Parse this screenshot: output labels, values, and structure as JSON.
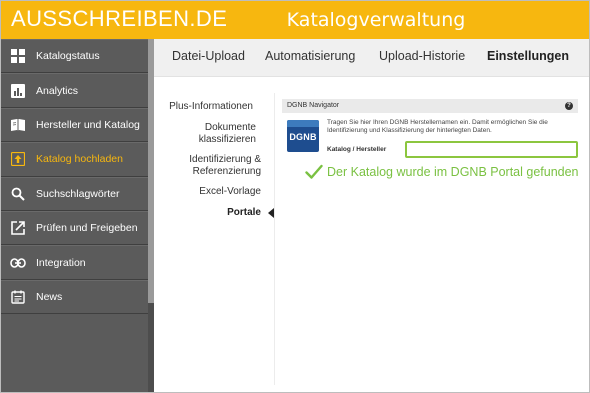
{
  "header": {
    "logo": "AUSSCHREIBEN",
    "logo_dot": ".",
    "logo_tld": "DE",
    "title": "Katalogverwaltung",
    "accent": "#f7b70f"
  },
  "sidebar": {
    "items": [
      {
        "label": "Katalogstatus",
        "icon": "grid-icon"
      },
      {
        "label": "Analytics",
        "icon": "chart-icon"
      },
      {
        "label": "Hersteller und Katalog",
        "icon": "book-icon"
      },
      {
        "label": "Katalog hochladen",
        "icon": "upload-icon",
        "active": true
      },
      {
        "label": "Suchschlagwörter",
        "icon": "search-icon"
      },
      {
        "label": "Prüfen und Freigeben",
        "icon": "external-link-icon"
      },
      {
        "label": "Integration",
        "icon": "link-icon"
      },
      {
        "label": "News",
        "icon": "news-icon"
      }
    ]
  },
  "tabs": [
    {
      "label": "Datei-Upload"
    },
    {
      "label": "Automatisierung"
    },
    {
      "label": "Upload-Historie"
    },
    {
      "label": "Einstellungen",
      "active": true
    }
  ],
  "subnav": {
    "items": [
      "Plus-Informationen",
      "Dokumente klassifizieren",
      "Identifizierung & Referenzierung",
      "Excel-Vorlage",
      "Portale"
    ],
    "active_index": 4
  },
  "panel": {
    "title": "DGNB Navigator",
    "help": "?",
    "logo_text": "DGNB",
    "intro": "Tragen Sie hier Ihren DGNB Herstellernamen ein. Damit ermöglichen Sie die Identifizierung und Klassifizierung der hinterlegten Daten.",
    "field_label": "Katalog / Hersteller",
    "field_value": "",
    "success_message": "Der Katalog wurde im DGNB Portal gefunden",
    "success_color": "#7ac142"
  }
}
